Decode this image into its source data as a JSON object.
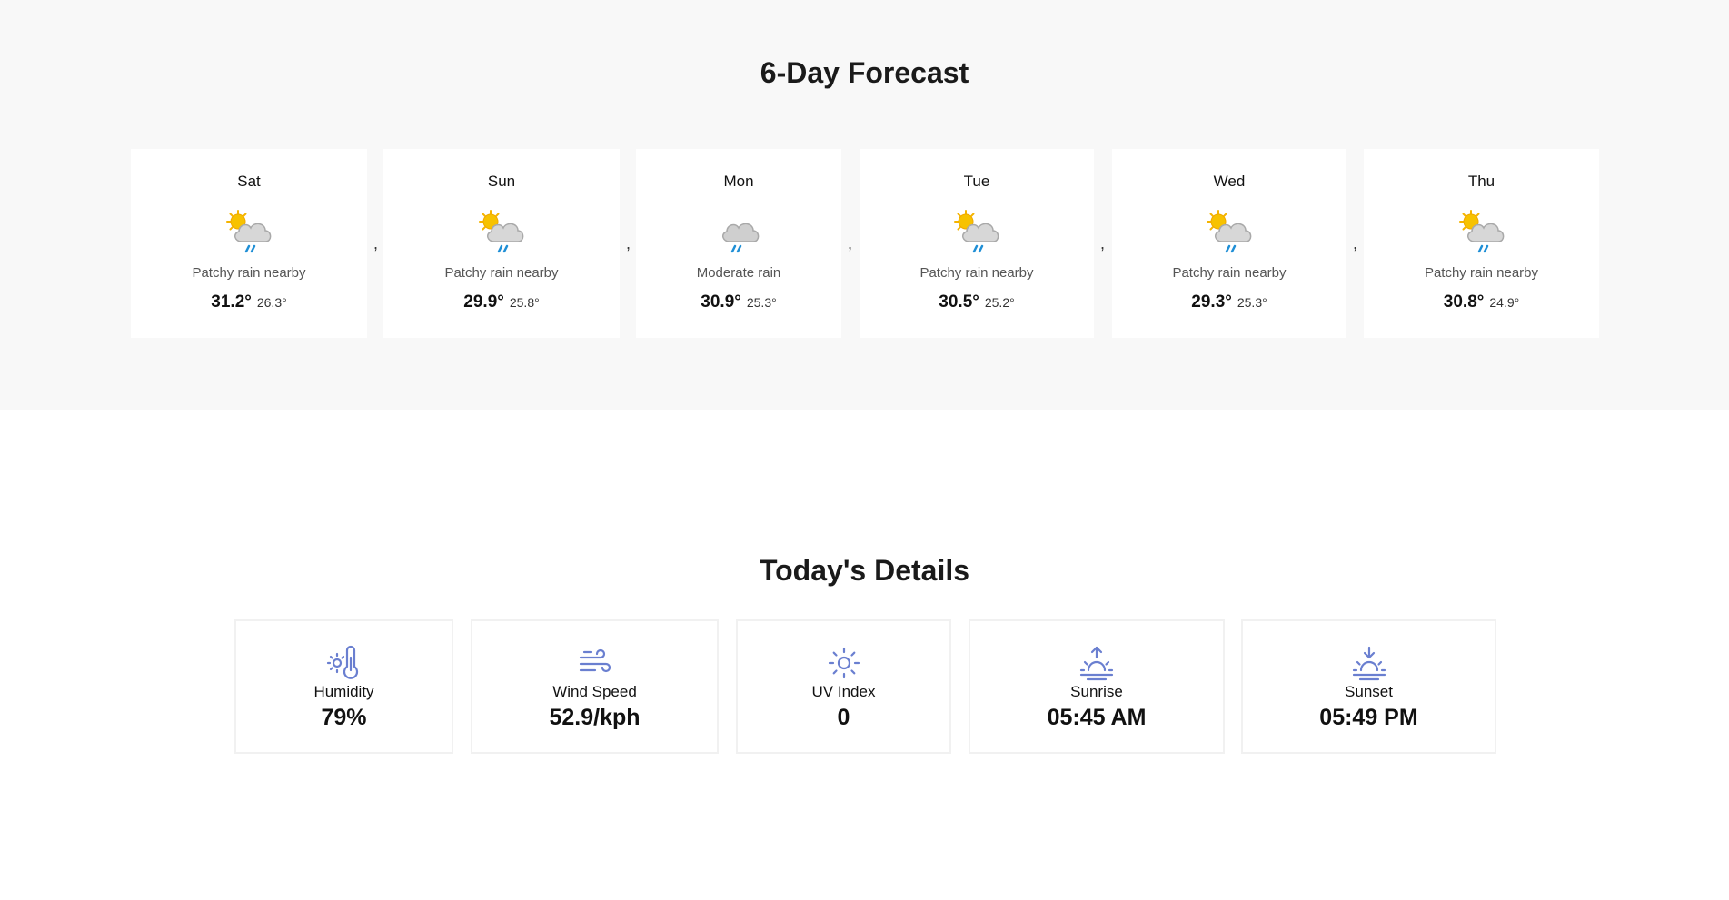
{
  "forecast": {
    "title": "6-Day Forecast",
    "separator": ",",
    "days": [
      {
        "day": "Sat",
        "condition": "Patchy rain nearby",
        "max": "31.2°",
        "min": "26.3°",
        "icon": "partly-cloudy-rain-icon"
      },
      {
        "day": "Sun",
        "condition": "Patchy rain nearby",
        "max": "29.9°",
        "min": "25.8°",
        "icon": "partly-cloudy-rain-icon"
      },
      {
        "day": "Mon",
        "condition": "Moderate rain",
        "max": "30.9°",
        "min": "25.3°",
        "icon": "cloud-rain-icon"
      },
      {
        "day": "Tue",
        "condition": "Patchy rain nearby",
        "max": "30.5°",
        "min": "25.2°",
        "icon": "partly-cloudy-rain-icon"
      },
      {
        "day": "Wed",
        "condition": "Patchy rain nearby",
        "max": "29.3°",
        "min": "25.3°",
        "icon": "partly-cloudy-rain-icon"
      },
      {
        "day": "Thu",
        "condition": "Patchy rain nearby",
        "max": "30.8°",
        "min": "24.9°",
        "icon": "partly-cloudy-rain-icon"
      }
    ]
  },
  "details": {
    "title": "Today's Details",
    "items": [
      {
        "label": "Humidity",
        "value": "79%",
        "icon": "thermometer-sun-icon"
      },
      {
        "label": "Wind Speed",
        "value": "52.9/kph",
        "icon": "wind-icon"
      },
      {
        "label": "UV Index",
        "value": "0",
        "icon": "sun-icon"
      },
      {
        "label": "Sunrise",
        "value": "05:45 AM",
        "icon": "sunrise-icon"
      },
      {
        "label": "Sunset",
        "value": "05:49 PM",
        "icon": "sunset-icon"
      }
    ]
  },
  "colors": {
    "section_bg": "#f8f8f8",
    "detail_icon": "#6a7fd0",
    "sun": "#f5b400",
    "cloud": "#cfcfcf",
    "rain": "#1f8fd6"
  }
}
